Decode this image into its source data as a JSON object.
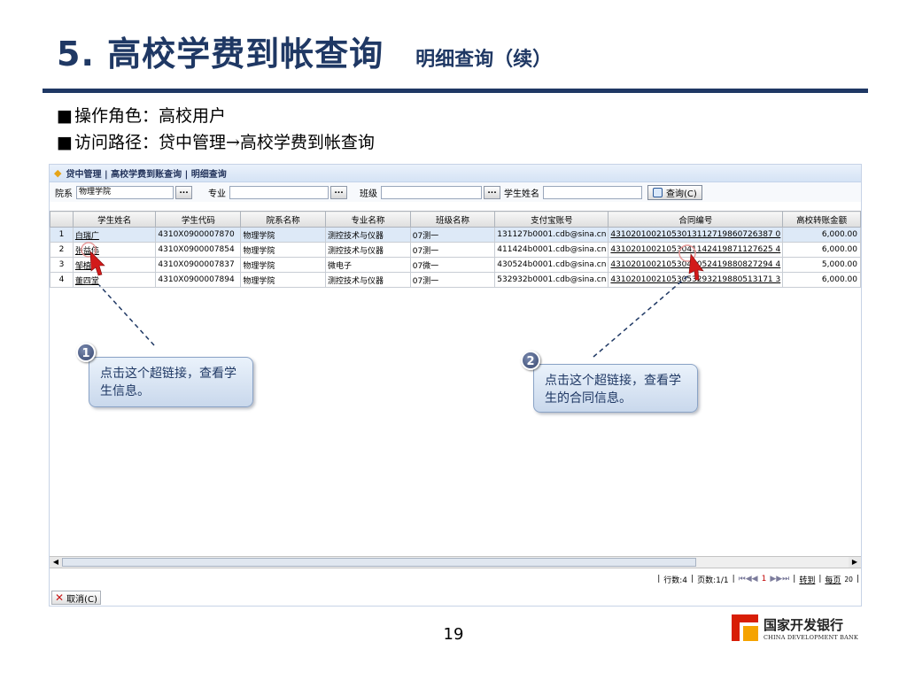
{
  "slide": {
    "title": "5. 高校学费到帐查询",
    "subtitle": "明细查询（续）",
    "bullets": [
      {
        "marker": "■",
        "text": "操作角色：高校用户"
      },
      {
        "marker": "■",
        "text": "访问路径：贷中管理→高校学费到帐查询"
      }
    ],
    "page_number": "19",
    "logo_cn": "国家开发银行",
    "logo_en": "CHINA DEVELOPMENT BANK"
  },
  "breadcrumb": {
    "text": "贷中管理 | 高校学费到账查询 | 明细查询"
  },
  "filter": {
    "dept_label": "院系",
    "dept_value": "物理学院",
    "major_label": "专业",
    "major_value": "",
    "class_label": "班级",
    "class_value": "",
    "name_label": "学生姓名",
    "name_value": "",
    "query_label": "查询(C)",
    "dots_label": "..."
  },
  "table": {
    "columns": [
      "",
      "学生姓名",
      "学生代码",
      "院系名称",
      "专业名称",
      "班级名称",
      "支付宝账号",
      "合同编号",
      "高校转账金额"
    ],
    "rows": [
      {
        "no": "1",
        "name": "白瑞广",
        "code": "4310X0900007870",
        "dept": "物理学院",
        "major": "测控技术与仪器",
        "class": "07测一",
        "alipay": "131127b0001.cdb@sina.cn",
        "contract": "43102010021053013112719860726387 0",
        "amount": "6,000.00"
      },
      {
        "no": "2",
        "name": "张益伟",
        "code": "4310X0900007854",
        "dept": "物理学院",
        "major": "测控技术与仪器",
        "class": "07测一",
        "alipay": "411424b0001.cdb@sina.cn",
        "contract": "43102010021053041142419871127625 4",
        "amount": "6,000.00"
      },
      {
        "no": "3",
        "name": "邹植",
        "code": "4310X0900007837",
        "dept": "物理学院",
        "major": "微电子",
        "class": "07微一",
        "alipay": "430524b0001.cdb@sina.cn",
        "contract": "43102010021053043052419880827294 4",
        "amount": "5,000.00"
      },
      {
        "no": "4",
        "name": "董四堂",
        "code": "4310X0900007894",
        "dept": "物理学院",
        "major": "测控技术与仪器",
        "class": "07测一",
        "alipay": "532932b0001.cdb@sina.cn",
        "contract": "43102010021053053293219880513171 3",
        "amount": "6,000.00"
      }
    ]
  },
  "pager": {
    "rows": "行数:4",
    "pages": "页数:1/1",
    "first_prev": "⏮◀◀",
    "current": "1",
    "next_last": "▶▶⏭",
    "goto": "转到",
    "per_page_label": "每页",
    "per_page_value": "20"
  },
  "cancel_label": "取消(C)",
  "callouts": [
    {
      "badge": "1",
      "text": "点击这个超链接，查看学生信息。"
    },
    {
      "badge": "2",
      "text": "点击这个超链接，查看学生的合同信息。"
    }
  ],
  "colors": {
    "title": "#1f3864",
    "rule": "#1f3864",
    "selected_row": "#dde9f7",
    "callout_bg": "#c9d8ec",
    "arrow": "#d21a1a"
  }
}
